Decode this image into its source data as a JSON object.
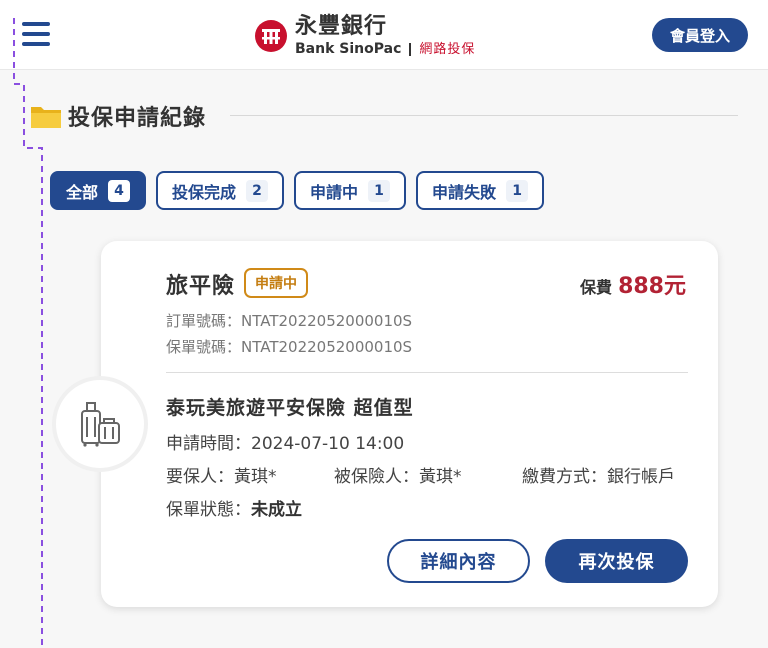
{
  "header": {
    "brand_cn": "永豐銀行",
    "brand_en": "Bank SinoPac",
    "brand_sub": "網路投保",
    "login_label": "會員登入"
  },
  "section": {
    "title": "投保申請紀錄"
  },
  "tabs": [
    {
      "label": "全部",
      "count": "4",
      "active": true
    },
    {
      "label": "投保完成",
      "count": "2",
      "active": false
    },
    {
      "label": "申請中",
      "count": "1",
      "active": false
    },
    {
      "label": "申請失敗",
      "count": "1",
      "active": false
    }
  ],
  "card": {
    "product": "旅平險",
    "status": "申請中",
    "premium_label": "保費",
    "premium_value": "888元",
    "order_no": "訂單號碼：NTAT2022052000010S",
    "policy_no": "保單號碼：NTAT2022052000010S",
    "plan": "泰玩美旅遊平安保險 超值型",
    "apply_time_label": "申請時間：",
    "apply_time": "2024-07-10 14:00",
    "proposer_label": "要保人：",
    "proposer": "黃琪*",
    "insured_label": "被保險人：",
    "insured": "黃琪*",
    "payment_label": "繳費方式：",
    "payment": "銀行帳戶",
    "policy_status_label": "保單狀態：",
    "policy_status": "未成立",
    "details_button": "詳細內容",
    "reapply_button": "再次投保"
  },
  "colors": {
    "primary": "#23498f",
    "premium": "#b22234",
    "status_badge": "#d08a18",
    "dash": "#8a4fe0"
  },
  "icons": [
    "menu-icon",
    "sinopac-logo-icon",
    "folder-icon",
    "luggage-icon"
  ]
}
